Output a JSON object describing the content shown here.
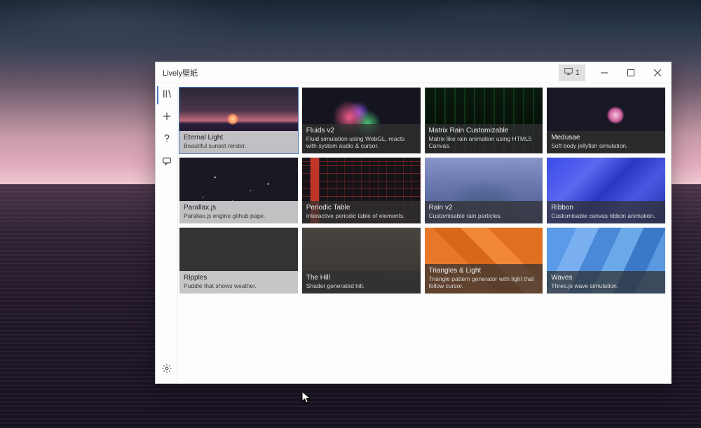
{
  "window": {
    "title": "Lively壁紙",
    "monitor_label": "1"
  },
  "sidebar": {
    "items": [
      {
        "name": "library"
      },
      {
        "name": "add"
      },
      {
        "name": "help"
      },
      {
        "name": "feedback"
      }
    ],
    "settings": "settings"
  },
  "wallpapers": [
    {
      "title": "Eternal Light",
      "desc": "Beautiful sunset render.",
      "thumb": "th-eternal",
      "selected": true,
      "dark": false
    },
    {
      "title": "Fluids v2",
      "desc": "Fluid simulation using WebGL, reacts with system audio & cursor.",
      "thumb": "th-fluids",
      "selected": false,
      "dark": true
    },
    {
      "title": "Matrix Rain Customizable",
      "desc": "Matrix like rain animation using HTML5 Canvas.",
      "thumb": "th-matrix",
      "selected": false,
      "dark": true
    },
    {
      "title": "Medusae",
      "desc": "Soft body jellyfish simulation.",
      "thumb": "th-medusae",
      "selected": false,
      "dark": true
    },
    {
      "title": "Parallax.js",
      "desc": "Parallax.js engine github page.",
      "thumb": "th-parallax",
      "selected": false,
      "dark": false
    },
    {
      "title": "Periodic Table",
      "desc": "Interactive periodic table of elements.",
      "thumb": "th-periodic",
      "selected": false,
      "dark": true
    },
    {
      "title": "Rain v2",
      "desc": "Customisable rain particles.",
      "thumb": "th-rain",
      "selected": false,
      "dark": true
    },
    {
      "title": "Ribbon",
      "desc": "Customisable canvas ribbon animation.",
      "thumb": "th-ribbon",
      "selected": false,
      "dark": true
    },
    {
      "title": "Ripples",
      "desc": "Puddle that shows weather.",
      "thumb": "th-ripples",
      "selected": false,
      "dark": false
    },
    {
      "title": "The Hill",
      "desc": "Shader generated hill.",
      "thumb": "th-hill",
      "selected": false,
      "dark": true
    },
    {
      "title": "Triangles & Light",
      "desc": "Triangle pattern generator with light that follow cursor.",
      "thumb": "th-triangles",
      "selected": false,
      "dark": true
    },
    {
      "title": "Waves",
      "desc": "Three.js wave simulation.",
      "thumb": "th-waves",
      "selected": false,
      "dark": true
    }
  ]
}
